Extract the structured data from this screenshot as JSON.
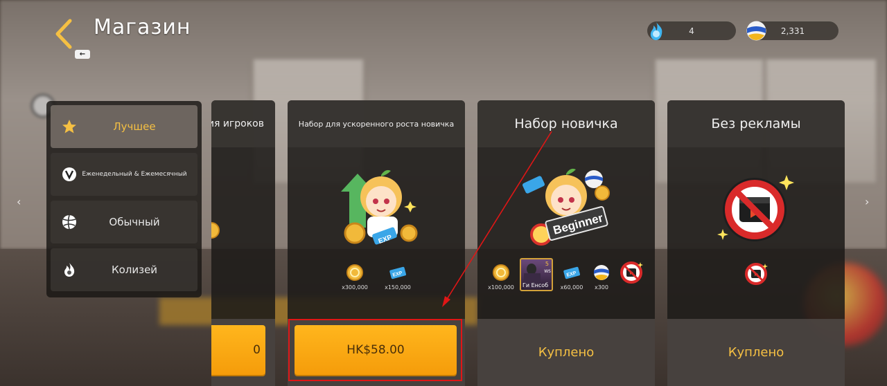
{
  "header": {
    "title": "Магазин",
    "back_icon": "chevron-left-icon",
    "back_hint": "←"
  },
  "currencies": [
    {
      "icon": "blue-flame-icon",
      "value": "4"
    },
    {
      "icon": "volleyball-icon",
      "value": "2,331"
    }
  ],
  "sidebar": {
    "items": [
      {
        "label": "Лучшее",
        "icon": "star-icon",
        "active": true
      },
      {
        "label": "Еженедельный & Ежемесячный",
        "icon": "v-badge-icon",
        "active": false
      },
      {
        "label": "Обычный",
        "icon": "volleyball-icon",
        "active": false
      },
      {
        "label": "Колизей",
        "icon": "flame-icon",
        "active": false
      }
    ]
  },
  "nav": {
    "left": "‹",
    "right": "›"
  },
  "cards": [
    {
      "title": "ия игроков",
      "button": "0"
    },
    {
      "title": "Набор для ускоренного роста новичка",
      "items": [
        {
          "icon": "gold-coin-icon",
          "qty": "x300,000"
        },
        {
          "icon": "exp-ticket-icon",
          "qty": "x150,000"
        }
      ],
      "button": "HK$58.00"
    },
    {
      "title": "Набор новичка",
      "badge_text": "Beginner",
      "items": [
        {
          "icon": "gold-coin-icon",
          "qty": "x100,000"
        },
        {
          "icon": "player-card-icon",
          "qty": "Ги Енсоб",
          "rank": "5",
          "tag": "WS"
        },
        {
          "icon": "exp-ticket-icon",
          "qty": "x60,000"
        },
        {
          "icon": "volleyball-icon",
          "qty": "x300"
        },
        {
          "icon": "no-ads-icon",
          "qty": ""
        }
      ],
      "status": "Куплено"
    },
    {
      "title": "Без рекламы",
      "items": [
        {
          "icon": "no-ads-icon",
          "qty": ""
        }
      ],
      "status": "Куплено"
    }
  ],
  "colors": {
    "accent": "#f5c043",
    "buy_button": "#ffa912",
    "highlight": "#e01616"
  }
}
